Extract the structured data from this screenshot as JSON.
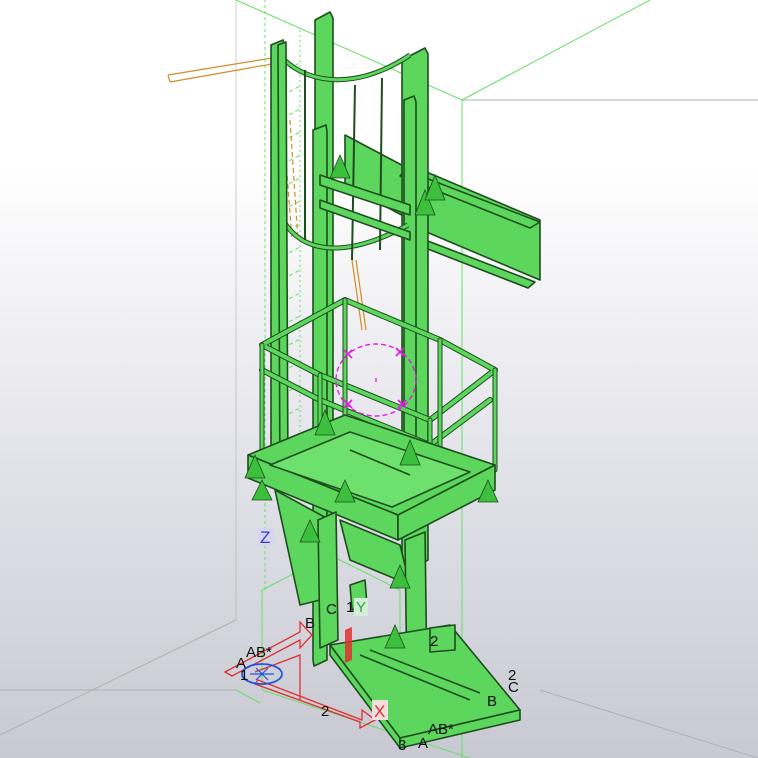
{
  "viewport": {
    "name": "3D model view",
    "background_top": "#ffffff",
    "background_bottom": "#c9c9d3"
  },
  "colors": {
    "member_fill": "#5cd65c",
    "member_stroke": "#1e4d1e",
    "grid_line": "#66e066",
    "axis_x": "#e03030",
    "axis_y": "#2aa84a",
    "axis_z": "#3a3acc",
    "work_plane": "#d28c28",
    "selection": "#e020e0",
    "load_arrow": "#3cbf3c"
  },
  "axes": {
    "x_label": "X",
    "y_label": "Y",
    "z_label": "Z"
  },
  "grid_labels": {
    "origin_a": "A",
    "origin_ab": "AB*",
    "origin_1": "1",
    "b_upper": "B",
    "c_upper": "C",
    "one_upper": "1",
    "two_mid": "2",
    "two_upper": "2",
    "two_right": "2",
    "b_right": "B",
    "c_right": "C",
    "three_bottom": "3",
    "a_bottom": "A",
    "ab_bottom": "AB*"
  },
  "icons": {
    "origin": "coordinate-origin-icon",
    "selection": "selection-handle-icon"
  }
}
